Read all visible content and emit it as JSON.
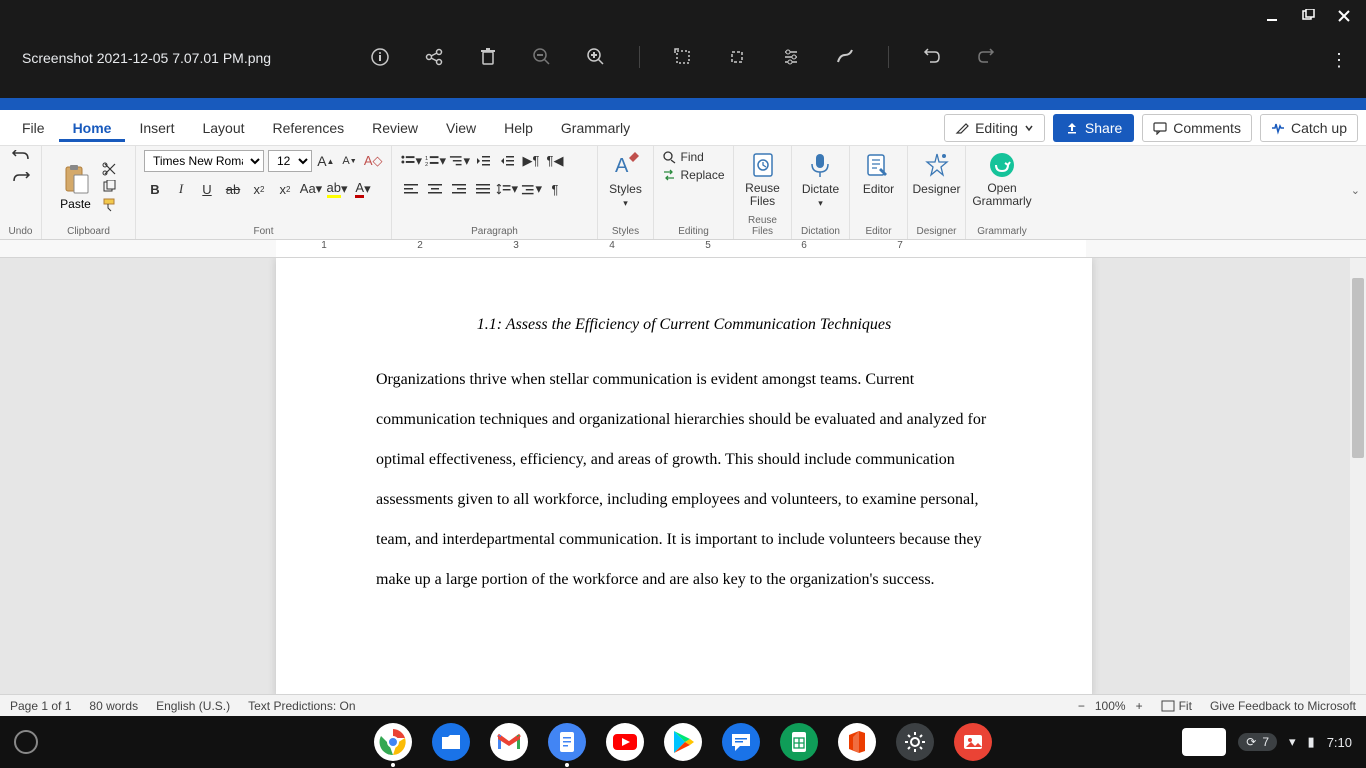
{
  "cros": {
    "filename": "Screenshot 2021-12-05 7.07.01 PM.png",
    "time": "7:10",
    "notif_count": "7"
  },
  "word": {
    "tabs": {
      "file": "File",
      "home": "Home",
      "insert": "Insert",
      "layout": "Layout",
      "references": "References",
      "review": "Review",
      "view": "View",
      "help": "Help",
      "grammarly": "Grammarly"
    },
    "mode": "Editing",
    "share": "Share",
    "comments": "Comments",
    "catchup": "Catch up",
    "ribbon": {
      "undo": "Undo",
      "clipboard": "Clipboard",
      "paste": "Paste",
      "font": "Font",
      "font_name": "Times New Roman",
      "font_size": "12",
      "paragraph": "Paragraph",
      "styles": "Styles",
      "editing": "Editing",
      "find": "Find",
      "replace": "Replace",
      "reuse_files": "Reuse Files",
      "reuse_files_btn": "Reuse Files",
      "dictate": "Dictate",
      "dictation": "Dictation",
      "editor": "Editor",
      "designer": "Designer",
      "open_grammarly": "Open Grammarly",
      "grammarly": "Grammarly"
    },
    "ruler_nums": [
      "1",
      "2",
      "3",
      "4",
      "5",
      "6",
      "7"
    ],
    "document": {
      "heading": "1.1: Assess the Efficiency of Current Communication Techniques",
      "body": "Organizations thrive when stellar communication is evident amongst teams. Current communication techniques and organizational hierarchies should be evaluated and analyzed for optimal effectiveness, efficiency, and areas of growth. This should include communication assessments given to all workforce, including employees and volunteers, to examine personal, team, and interdepartmental communication. It is important to include volunteers because they make up a large portion of the workforce and are also key to the organization's success."
    },
    "status": {
      "page": "Page 1 of 1",
      "words": "80 words",
      "lang": "English (U.S.)",
      "predictions": "Text Predictions: On",
      "zoom": "100%",
      "fit": "Fit",
      "feedback": "Give Feedback to Microsoft"
    }
  }
}
